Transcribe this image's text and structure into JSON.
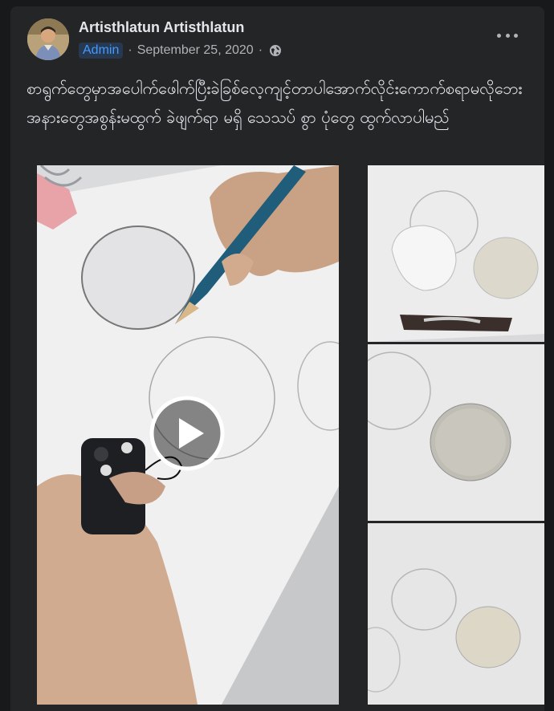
{
  "post": {
    "author": "Artisthlatun Artisthlatun",
    "role_badge": "Admin",
    "separator": "·",
    "date": "September 25, 2020",
    "privacy_icon": "globe-icon",
    "more_icon": "more-options-icon",
    "text": "စာရွက်တွေမှာအပေါက်ဖေါက်ပြီးခဲခြစ်လေ့ကျင့်တာပါအောက်လိုင်းကောက်စရာမလိုဘေးအနားတွေအစွန်းမထွက် ခဲဖျက်ရာ မရှိ သေသပ် စွာ ပုံတွေ ထွက်လာပါမည်"
  },
  "media": {
    "main_kind": "video",
    "play_icon": "play-icon",
    "thumbnails": [
      "photo-1",
      "photo-2",
      "photo-3"
    ]
  },
  "colors": {
    "background": "#18191a",
    "card": "#242526",
    "text_primary": "#e4e6eb",
    "text_secondary": "#b0b3b8",
    "badge_bg": "#263951",
    "badge_text": "#4599ff"
  }
}
